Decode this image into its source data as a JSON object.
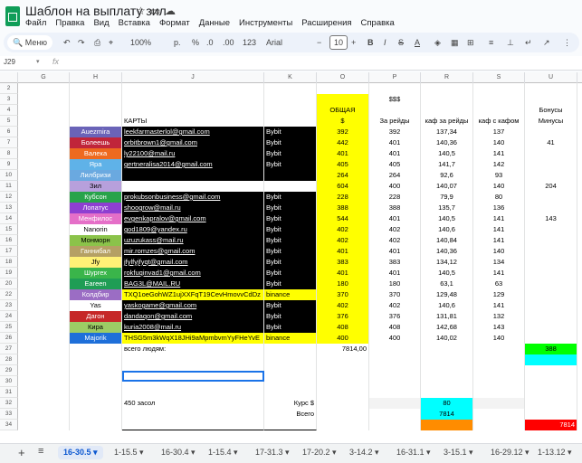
{
  "header": {
    "title": "Шаблон на выплату зил",
    "star_icon": "star-icon",
    "move_icon": "folder-icon",
    "cloud_icon": "cloud-icon"
  },
  "menu": [
    "Файл",
    "Правка",
    "Вид",
    "Вставка",
    "Формат",
    "Данные",
    "Инструменты",
    "Расширения",
    "Справка"
  ],
  "toolbar": {
    "search": "Меню",
    "zoom": "100%",
    "currency": "р.",
    "percent": "%",
    "dec_less": ".0",
    "dec_more": ".00",
    "format_123": "123",
    "font": "Arial",
    "font_size": "10",
    "bold": "B",
    "italic": "I",
    "strike": "S",
    "text_color": "A"
  },
  "formula": {
    "name_box": "J29",
    "fx": "fx"
  },
  "columns": [
    "G",
    "H",
    "J",
    "K",
    "O",
    "P",
    "R",
    "S",
    "U"
  ],
  "rows": [
    {
      "n": "2",
      "cells": {}
    },
    {
      "n": "3",
      "cells": {
        "P": "$$$"
      }
    },
    {
      "n": "4",
      "cells": {
        "O": "ОБЩАЯ",
        "U": "Бонусы"
      }
    },
    {
      "n": "5",
      "cells": {
        "J": "КАРТЫ",
        "O": "$",
        "P": "За рейды",
        "R": "каф за рейды",
        "S": "каф с кафом",
        "U": "Минусы"
      }
    },
    {
      "n": "6",
      "cells": {
        "H": "Auezmira",
        "J": "leekfarmasterlol@gmail.com",
        "K": "Bybit",
        "O": "392",
        "P": "392",
        "R": "137,34",
        "S": "137"
      },
      "hc": "#6a63b8"
    },
    {
      "n": "7",
      "cells": {
        "H": "Болеешь",
        "J": "orbitbrown1@gmail.com",
        "K": "Bybit",
        "O": "442",
        "P": "401",
        "R": "140,36",
        "S": "140",
        "U": "41"
      },
      "hc": "#c0253a"
    },
    {
      "n": "8",
      "cells": {
        "H": "Валека",
        "J": "ly22100@mail.ru",
        "K": "Bybit",
        "O": "401",
        "P": "401",
        "R": "140,5",
        "S": "141"
      },
      "hc": "#ee6a1f"
    },
    {
      "n": "9",
      "cells": {
        "H": "Яра",
        "J": "gertneralisa2014@gmail.com",
        "K": "Bybit",
        "O": "405",
        "P": "405",
        "R": "141,7",
        "S": "142"
      },
      "hc": "#5fb2e8"
    },
    {
      "n": "10",
      "cells": {
        "H": "Лилбризи",
        "O": "264",
        "P": "264",
        "R": "92,6",
        "S": "93"
      },
      "hc": "#6aa9e0"
    },
    {
      "n": "11",
      "cells": {
        "H": "Зил",
        "O": "604",
        "P": "400",
        "R": "140,07",
        "S": "140",
        "U": "204"
      },
      "hc": "#b7a0dc"
    },
    {
      "n": "12",
      "cells": {
        "H": "Кубсон",
        "J": "prokubsonbusiness@gmail.com",
        "K": "Bybit",
        "O": "228",
        "P": "228",
        "R": "79,9",
        "S": "80"
      },
      "hc": "#28a34a"
    },
    {
      "n": "13",
      "cells": {
        "H": "Лопатус",
        "J": "shoogrow@mail.ru",
        "K": "Bybit",
        "O": "388",
        "P": "388",
        "R": "135,7",
        "S": "136"
      },
      "hc": "#8e3fd1"
    },
    {
      "n": "14",
      "cells": {
        "H": "Менфилос",
        "J": "evgenkapralov@gmail.com",
        "K": "Bybit",
        "O": "544",
        "P": "401",
        "R": "140,5",
        "S": "141",
        "U": "143"
      },
      "hc": "#e56fc8"
    },
    {
      "n": "15",
      "cells": {
        "H": "Nanorin",
        "J": "god1809@yandex.ru",
        "K": "Bybit",
        "O": "402",
        "P": "402",
        "R": "140,6",
        "S": "141"
      },
      "hc": "#ffffff"
    },
    {
      "n": "16",
      "cells": {
        "H": "Монморн",
        "J": "uzuzukass@mail.ru",
        "K": "Bybit",
        "O": "402",
        "P": "402",
        "R": "140,84",
        "S": "141"
      },
      "hc": "#8bc34a"
    },
    {
      "n": "17",
      "cells": {
        "H": "Ганнибал",
        "J": "mir.romzes@gmail.com",
        "K": "Bybit",
        "O": "401",
        "P": "401",
        "R": "140,36",
        "S": "140"
      },
      "hc": "#b5a064"
    },
    {
      "n": "18",
      "cells": {
        "H": "Jfy",
        "J": "jfylfyjfyqt@gmail.com",
        "K": "Bybit",
        "O": "383",
        "P": "383",
        "R": "134,12",
        "S": "134"
      },
      "hc": "#fff176"
    },
    {
      "n": "19",
      "cells": {
        "H": "Шургех",
        "J": "rokfuqinvad1@gmail.com",
        "K": "Bybit",
        "O": "401",
        "P": "401",
        "R": "140,5",
        "S": "141"
      },
      "hc": "#3ab54a"
    },
    {
      "n": "20",
      "cells": {
        "H": "Eareen",
        "J": "BAG3L@MAIL.RU",
        "K": "Bybit",
        "O": "180",
        "P": "180",
        "R": "63,1",
        "S": "63"
      },
      "hc": "#1f9d55"
    },
    {
      "n": "22",
      "cells": {
        "H": "Колдбир",
        "J": "TXQ1oeGohWZ1ujXXFqT19CevHmovvCdDz",
        "K": "binance",
        "O": "370",
        "P": "370",
        "R": "129,48",
        "S": "129"
      },
      "hc": "#9b6dc4"
    },
    {
      "n": "23",
      "cells": {
        "H": "Yas",
        "J": "yaskogame@gmail.com",
        "K": "Bybit",
        "O": "402",
        "P": "402",
        "R": "140,6",
        "S": "141"
      },
      "hc": "#ffffff"
    },
    {
      "n": "24",
      "cells": {
        "H": "Дагон",
        "J": "dandaqon@gmail.com",
        "K": "Bybit",
        "O": "376",
        "P": "376",
        "R": "131,81",
        "S": "132"
      },
      "hc": "#c62828"
    },
    {
      "n": "25",
      "cells": {
        "H": "Кира",
        "J": "kuria2008@mail.ru",
        "K": "Bybit",
        "O": "408",
        "P": "408",
        "R": "142,68",
        "S": "143"
      },
      "hc": "#9ccc65"
    },
    {
      "n": "26",
      "cells": {
        "H": "Majorik",
        "J": "THSG5m3kWqX18JHi9aMpmbvmYyFHeYvE",
        "K": "binance",
        "O": "400",
        "P": "400",
        "R": "140,02",
        "S": "140"
      },
      "hc": "#1e6fd9"
    },
    {
      "n": "27",
      "cells": {
        "J": "всего людям:",
        "O": "7814,00"
      }
    },
    {
      "n": "28",
      "cells": {}
    },
    {
      "n": "29",
      "cells": {}
    },
    {
      "n": "30",
      "cells": {}
    },
    {
      "n": "31",
      "cells": {}
    },
    {
      "n": "32",
      "cells": {
        "J": "450 засол",
        "K": "Курс $",
        "R": "80"
      }
    },
    {
      "n": "33",
      "cells": {
        "K": "Всего",
        "R": "7814"
      }
    },
    {
      "n": "34",
      "cells": {}
    }
  ],
  "right_extra": {
    "u27": "388",
    "u34": "7814"
  },
  "tabs": [
    "16-30.5",
    "1-15.5",
    "16-30.4",
    "1-15.4",
    "17-31.3",
    "17-20.2",
    "3-14.2",
    "16-31.1",
    "3-15.1",
    "16-29.12",
    "1-13.12"
  ],
  "colors": {
    "yellow": "#ffff00",
    "cyan": "#00ffff",
    "orange": "#ff8c00",
    "red": "#ff0000",
    "green": "#00ff00",
    "accent": "#0b57d0"
  }
}
